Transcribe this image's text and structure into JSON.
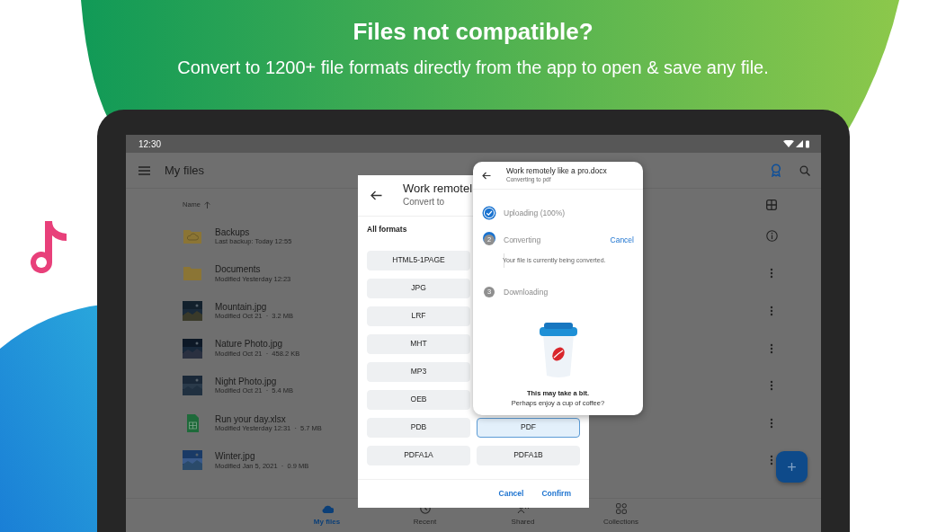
{
  "banner": {
    "title": "Files not compatible?",
    "subtitle": "Convert to 1200+ file formats directly from the app to open & save any file."
  },
  "status_bar": {
    "time": "12:30"
  },
  "app_bar": {
    "title": "My files"
  },
  "list_header": {
    "label": "Name"
  },
  "files": [
    {
      "kind": "cloud-folder",
      "name": "Backups",
      "meta": "Last backup: Today 12:55",
      "info": true
    },
    {
      "kind": "folder",
      "name": "Documents",
      "meta": "Modified Yesterday 12:23",
      "info": false
    },
    {
      "name": "Mountain.jpg",
      "meta": "Modified Oct 21  ·  3.2 MB",
      "info": false
    },
    {
      "name": "Nature Photo.jpg",
      "meta": "Modified Oct 21  ·  458.2 KB",
      "info": false
    },
    {
      "name": "Night Photo.jpg",
      "meta": "Modified Oct 21  ·  5.4 MB",
      "info": false
    },
    {
      "kind": "spreadsheet",
      "name": "Run your day.xlsx",
      "meta": "Modified Yesterday 12:31  ·  5.7 MB",
      "info": false
    },
    {
      "name": "Winter.jpg",
      "meta": "Modified Jan 5, 2021  ·  0.9 MB",
      "info": false
    }
  ],
  "nav": [
    {
      "label": "My files",
      "kind": "cloud",
      "selected": true
    },
    {
      "label": "Recent",
      "kind": "clock",
      "selected": false
    },
    {
      "label": "Shared",
      "kind": "people",
      "selected": false
    },
    {
      "label": "Collections",
      "kind": "grid",
      "selected": false
    }
  ],
  "fab": {
    "label": "+"
  },
  "convert_dialog": {
    "title": "Work remotel",
    "subtitle": "Convert to",
    "section": "All formats",
    "rows": [
      {
        "left": {
          "label": "HTML5-1PAGE",
          "selected": false
        }
      },
      {
        "left": {
          "label": "JPG",
          "selected": false
        }
      },
      {
        "left": {
          "label": "LRF",
          "selected": false
        }
      },
      {
        "left": {
          "label": "MHT",
          "selected": false
        }
      },
      {
        "left": {
          "label": "MP3",
          "selected": false
        }
      },
      {
        "left": {
          "label": "OEB",
          "selected": false
        }
      },
      {
        "left": {
          "label": "PDB",
          "selected": false
        },
        "right": {
          "label": "PDF",
          "selected": true
        }
      },
      {
        "left": {
          "label": "PDFA1A",
          "selected": false
        },
        "right": {
          "label": "PDFA1B",
          "selected": false
        }
      }
    ],
    "buttons": [
      "Cancel",
      "Confirm"
    ]
  },
  "progress_dialog": {
    "title": "Work remotely like a pro.docx",
    "subtitle": "Converting to pdf",
    "steps": [
      {
        "done": true,
        "active": false,
        "label": "Uploading (100%)"
      },
      {
        "done": false,
        "active": true,
        "number": "2",
        "label": "Converting",
        "action": "Cancel",
        "note": "Your file is currently being converted."
      },
      {
        "done": false,
        "active": false,
        "number": "3",
        "label": "Downloading"
      }
    ],
    "message": "This may take a bit.",
    "hint": "Perhaps enjoy a cup of coffee?"
  }
}
